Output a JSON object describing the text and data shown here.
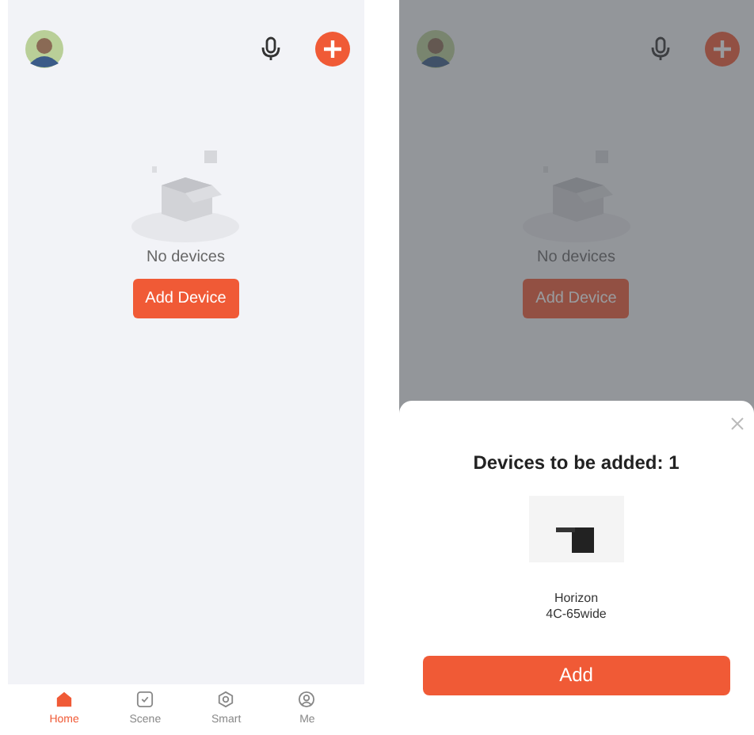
{
  "screens": [
    {
      "empty_text": "No devices",
      "add_button": "Add Device",
      "tabs": [
        {
          "label": "Home",
          "kind": "home",
          "selected": true
        },
        {
          "label": "Scene",
          "kind": "scene",
          "selected": false
        },
        {
          "label": "Smart",
          "kind": "smart",
          "selected": false
        },
        {
          "label": "Me",
          "kind": "me",
          "selected": false
        }
      ]
    },
    {
      "empty_text": "No devices",
      "add_button": "Add Device",
      "dimmed": true,
      "sheet": {
        "title": "Devices to be added: 1",
        "device_name": "Horizon\n4C-65wide",
        "add_button": "Add"
      }
    }
  ]
}
